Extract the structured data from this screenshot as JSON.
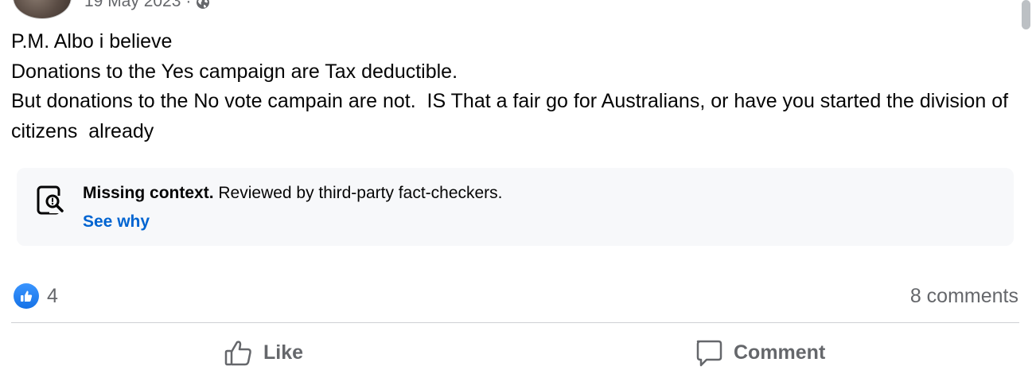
{
  "post": {
    "date": "19 May 2023",
    "separator": "·",
    "audience_icon": "globe-icon",
    "lines": [
      "P.M. Albo i believe",
      "Donations to the Yes campaign are Tax deductible.",
      "But donations to the No vote campain are not.  IS That a fair go for Australians, or have you started the division of citizens  already"
    ]
  },
  "fact_check": {
    "icon": "fact-check-magnifier-icon",
    "label": "Missing context.",
    "description": "Reviewed by third-party fact-checkers.",
    "link_label": "See why"
  },
  "engagement": {
    "reaction_icon": "like-reaction-icon",
    "reaction_count": "4",
    "comments_label": "8 comments"
  },
  "actions": {
    "like_label": "Like",
    "comment_label": "Comment"
  },
  "colors": {
    "link_blue": "#0064d1",
    "like_blue": "#1877f2",
    "secondary_text": "#65676b",
    "factcheck_bg": "#f7f8fa"
  }
}
